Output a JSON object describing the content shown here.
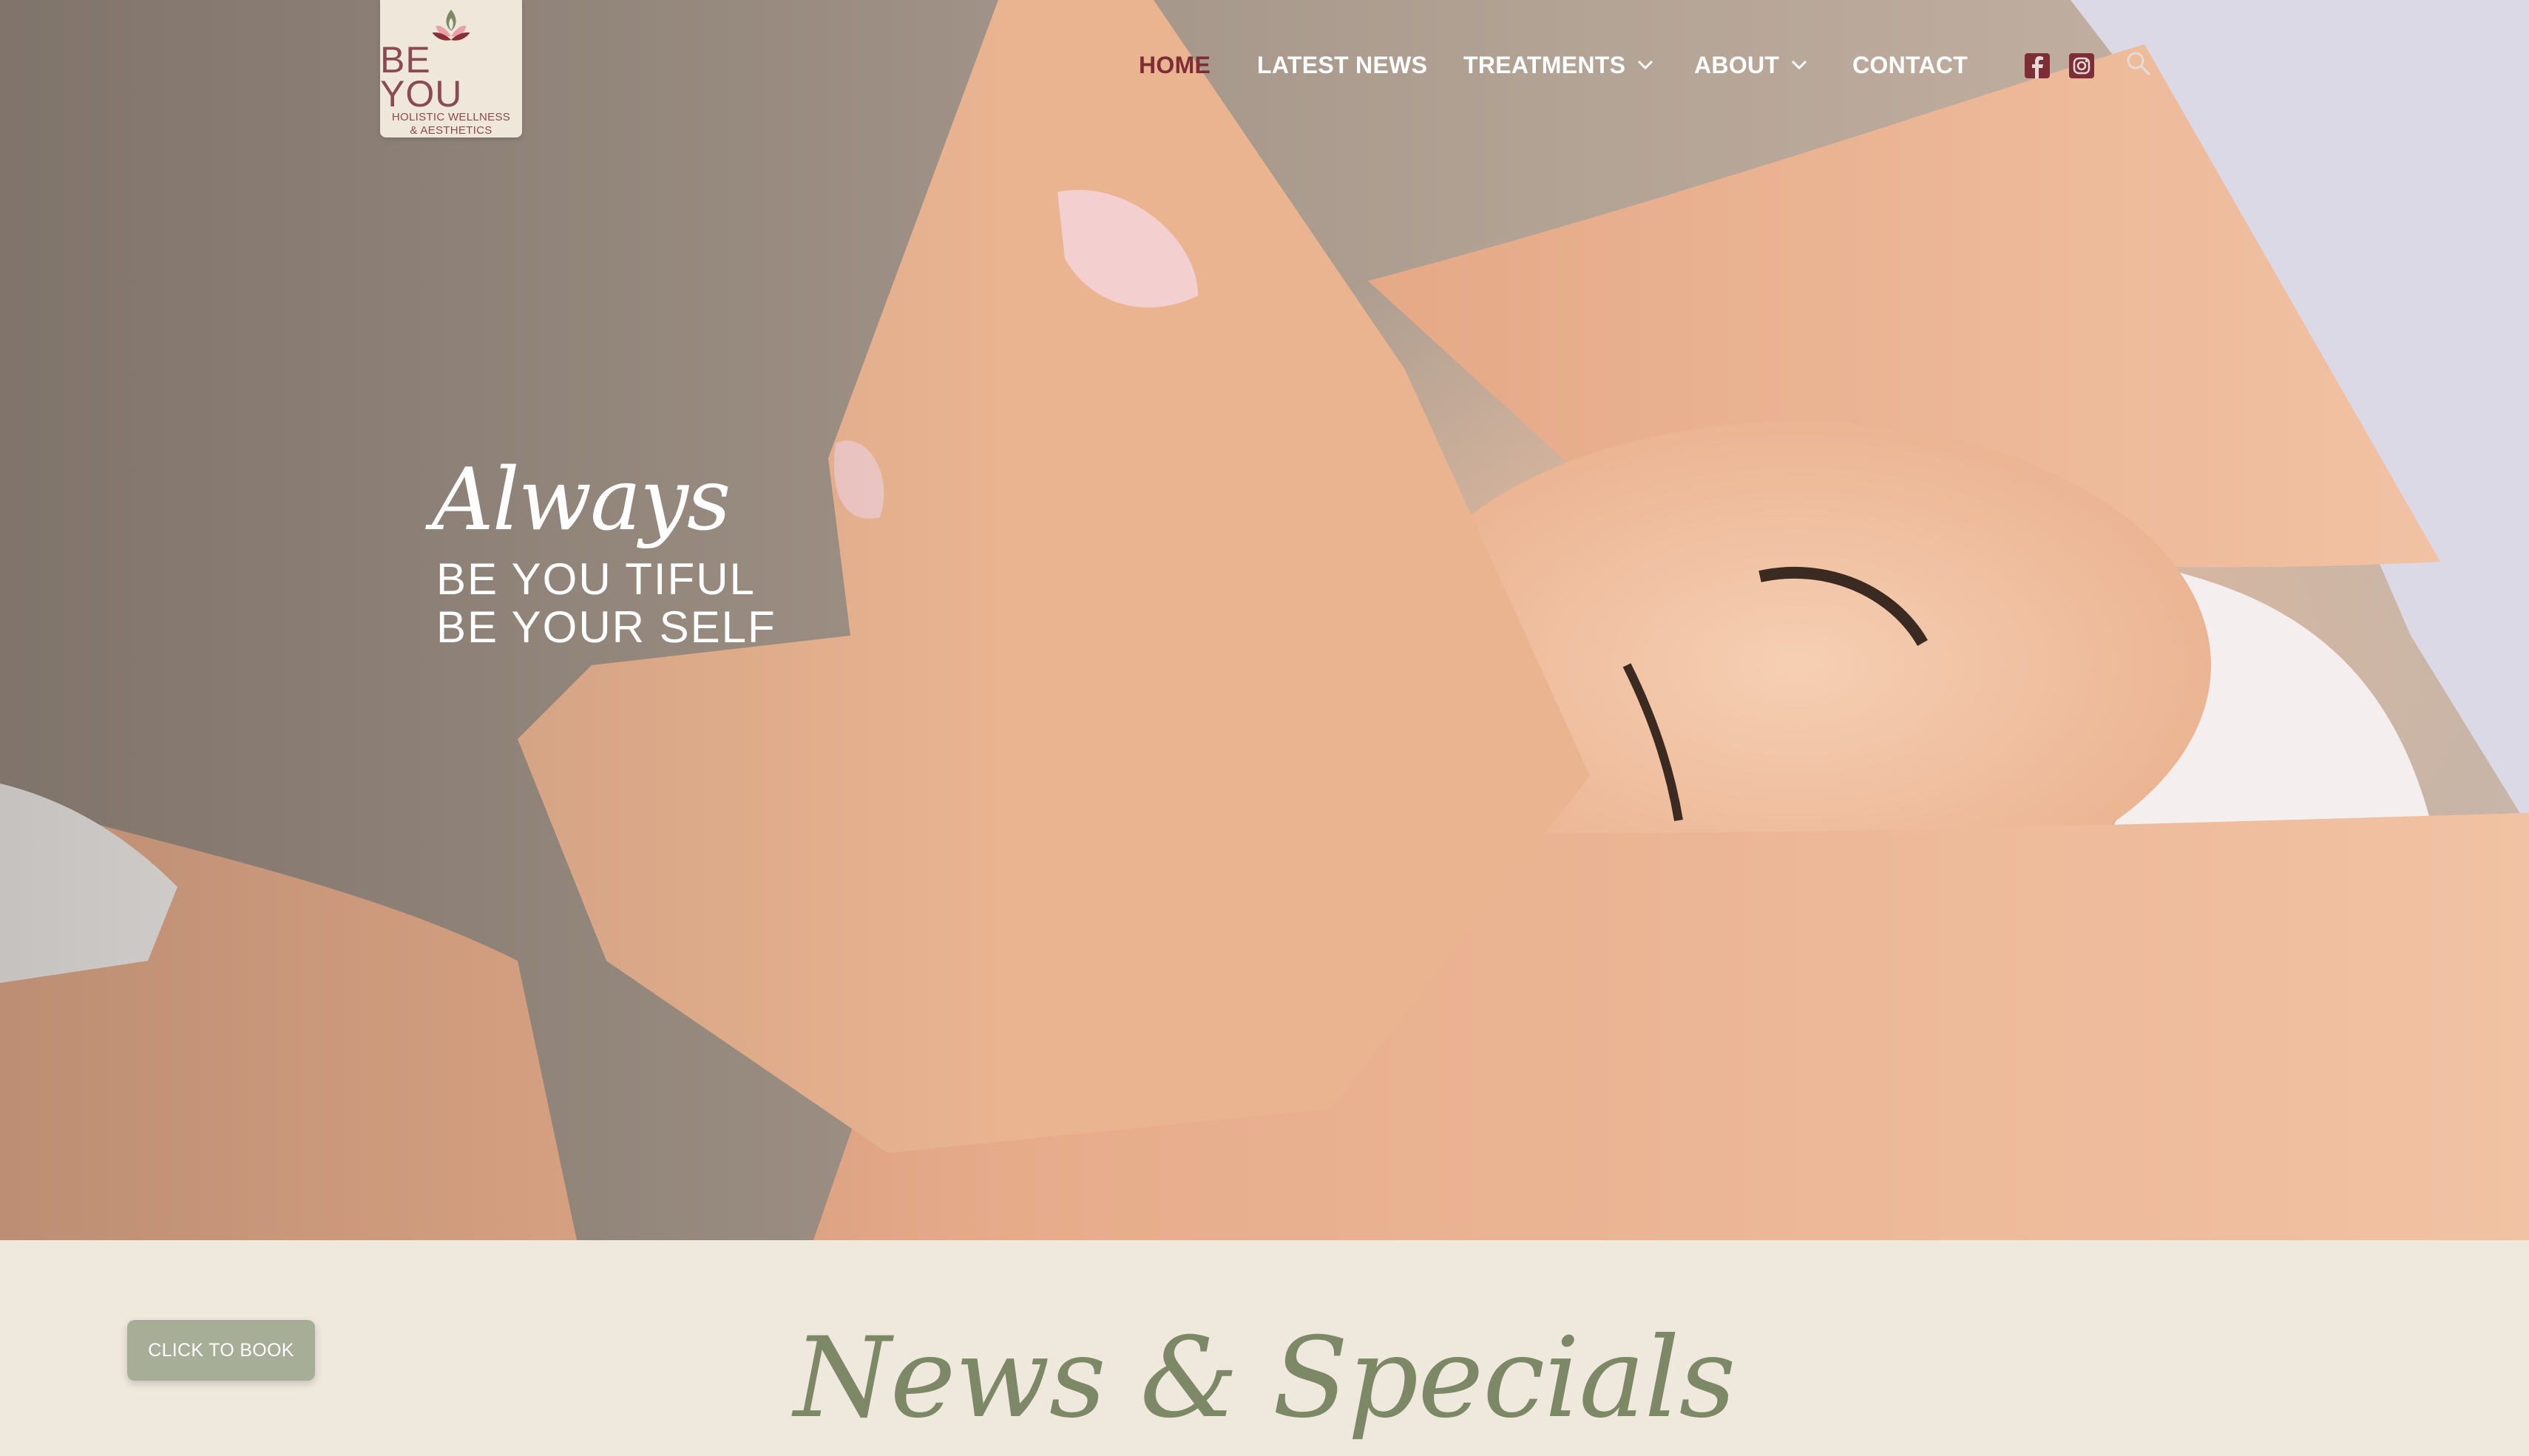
{
  "brand": {
    "name": "BE YOU",
    "subtitle_line1": "HOLISTIC WELLNESS",
    "subtitle_line2": "& AESTHETICS",
    "logo_icon": "lotus-icon"
  },
  "nav": {
    "items": [
      {
        "label": "HOME",
        "active": true,
        "dropdown": false
      },
      {
        "label": "LATEST NEWS",
        "active": false,
        "dropdown": false
      },
      {
        "label": "TREATMENTS",
        "active": false,
        "dropdown": true
      },
      {
        "label": "ABOUT",
        "active": false,
        "dropdown": true
      },
      {
        "label": "CONTACT",
        "active": false,
        "dropdown": false
      }
    ],
    "social_icons": [
      "facebook-icon",
      "instagram-icon"
    ],
    "search_icon": "search-icon"
  },
  "hero": {
    "script_word": "Always",
    "line1": "BE YOU TIFUL",
    "line2": "BE YOUR SELF"
  },
  "book_button": {
    "label": "CLICK TO BOOK"
  },
  "news_section": {
    "title": "News & Specials"
  },
  "colors": {
    "accent_maroon": "#7d2d36",
    "sage_button": "#a7ae98",
    "sage_title": "#7d8866",
    "section_bg": "#efe8dc"
  }
}
